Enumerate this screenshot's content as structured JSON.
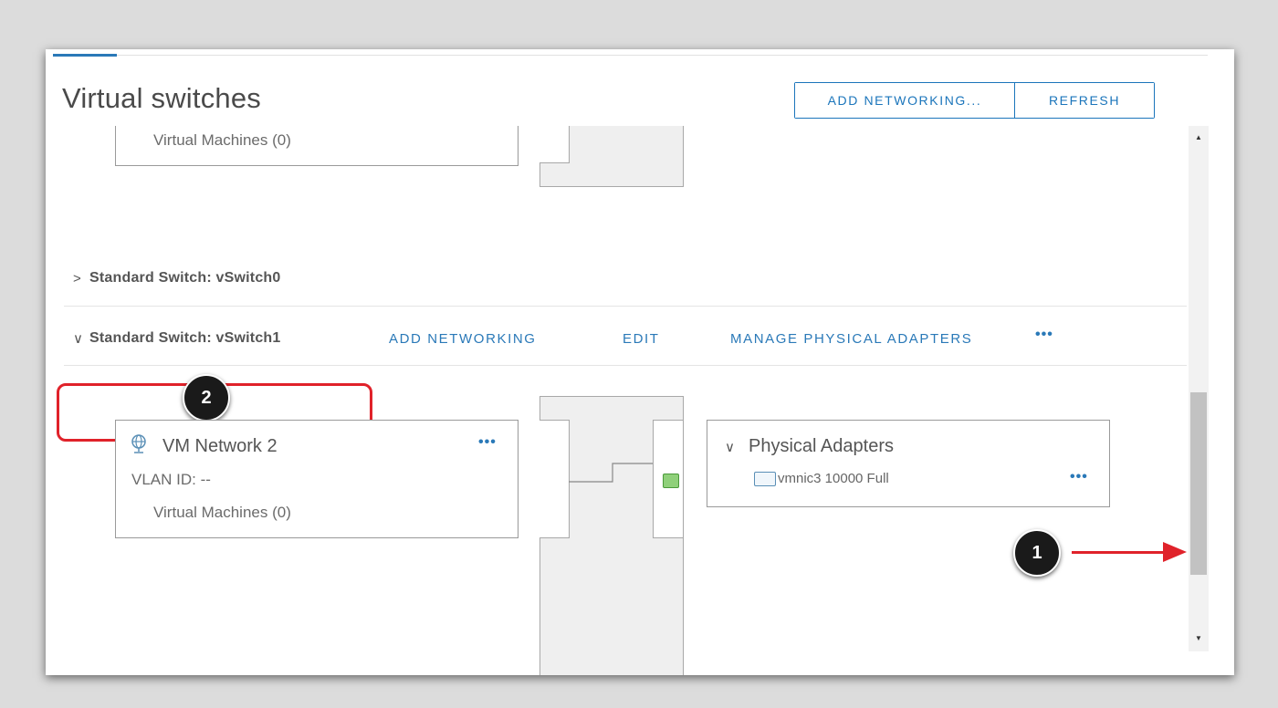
{
  "header": {
    "title": "Virtual switches",
    "add_networking_label": "ADD NETWORKING...",
    "refresh_label": "REFRESH"
  },
  "top_partial": {
    "vms_label": "Virtual Machines (0)"
  },
  "switches": [
    {
      "label": "Standard Switch: vSwitch0",
      "expanded": false
    },
    {
      "label": "Standard Switch: vSwitch1",
      "expanded": true
    }
  ],
  "switch_actions": {
    "add_networking": "ADD NETWORKING",
    "edit": "EDIT",
    "manage_physical_adapters": "MANAGE PHYSICAL ADAPTERS",
    "more": "•••"
  },
  "port_group": {
    "name": "VM Network 2",
    "vlan": "VLAN ID: --",
    "vms_label": "Virtual Machines (0)",
    "more": "•••"
  },
  "physical_adapters": {
    "title": "Physical Adapters",
    "adapter": "vmnic3 10000 Full",
    "more": "•••"
  },
  "annotations": {
    "badge_1": "1",
    "badge_2": "2"
  },
  "colors": {
    "accent": "#1b75bb",
    "highlight": "#e0222a",
    "link": "#2a79b8"
  }
}
